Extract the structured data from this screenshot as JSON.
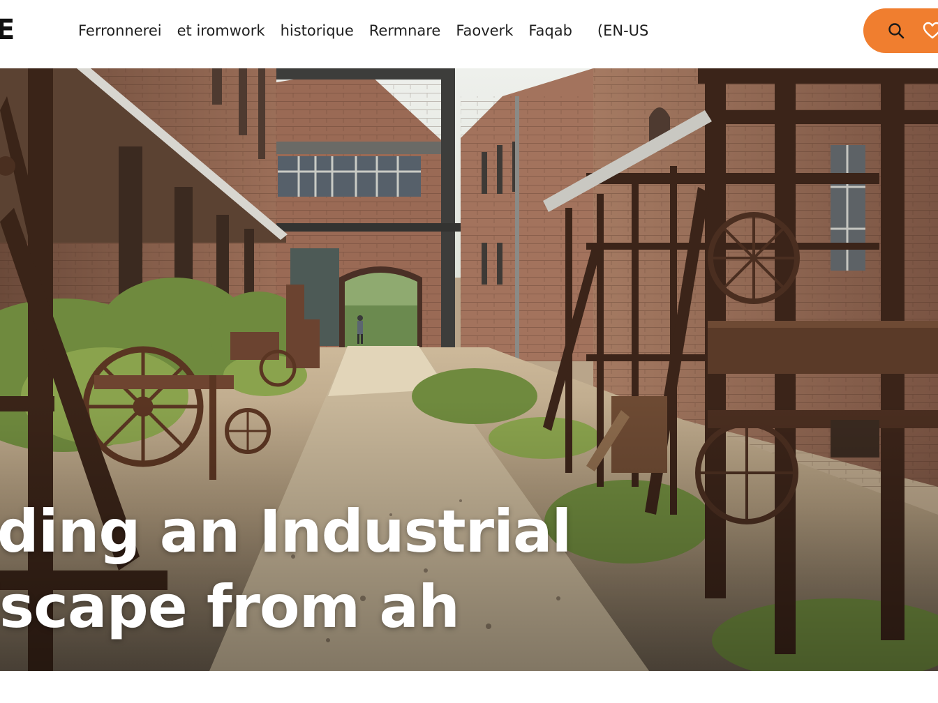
{
  "header": {
    "logo_text": "E",
    "nav": [
      {
        "label": "Ferronnerei"
      },
      {
        "label": "et iromwork"
      },
      {
        "label": "historique"
      },
      {
        "label": "Rermnare"
      },
      {
        "label": "Faoverk"
      },
      {
        "label": "Faqab"
      },
      {
        "label": "(EN-US"
      }
    ],
    "actions": [
      {
        "icon": "search-icon"
      },
      {
        "icon": "heart-icon"
      }
    ]
  },
  "hero": {
    "headline_line1": "ading an Industrial",
    "headline_line2": "dscape from ah",
    "image_subject": "industrial-courtyard-photo"
  },
  "colors": {
    "accent": "#f07e2f",
    "header_bg": "#ffffff",
    "nav_text": "#1f1f1f",
    "headline_text": "#ffffff"
  }
}
